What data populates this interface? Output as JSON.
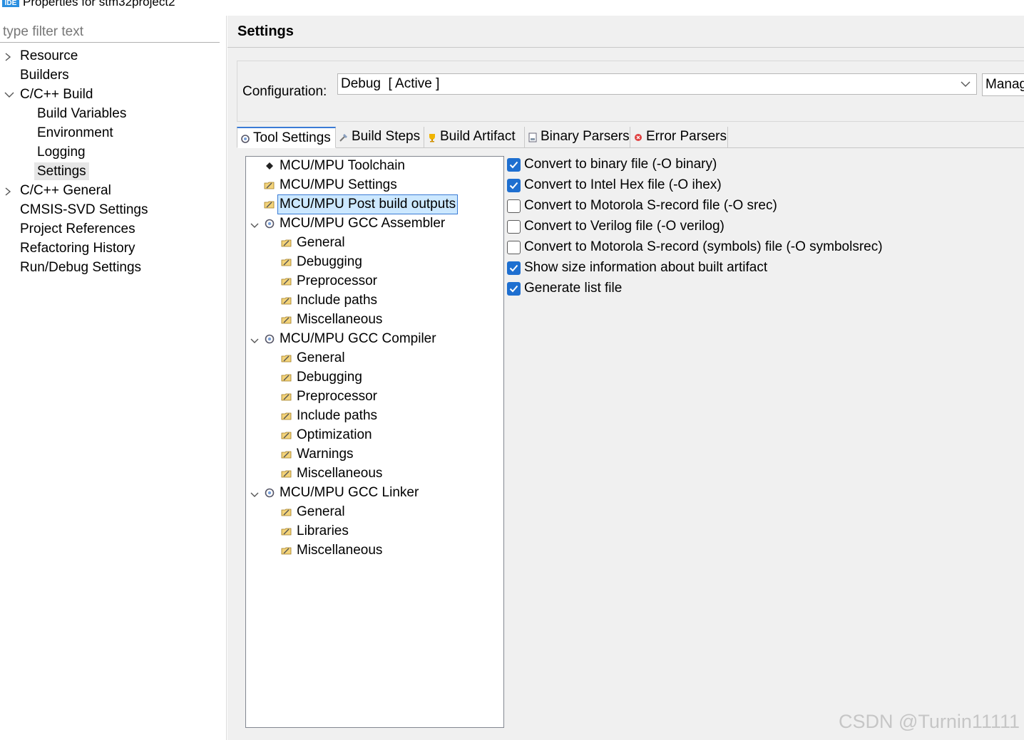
{
  "window": {
    "title": "Properties for stm32project2",
    "icon_text": "IDE"
  },
  "filter": {
    "placeholder": "type filter text"
  },
  "nav": {
    "items": [
      {
        "label": "Resource",
        "chevron": "right"
      },
      {
        "label": "Builders"
      },
      {
        "label": "C/C++ Build",
        "chevron": "down"
      },
      {
        "label": "Build Variables"
      },
      {
        "label": "Environment"
      },
      {
        "label": "Logging"
      },
      {
        "label": "Settings",
        "selected": true
      },
      {
        "label": "C/C++ General",
        "chevron": "right"
      },
      {
        "label": "CMSIS-SVD Settings"
      },
      {
        "label": "Project References"
      },
      {
        "label": "Refactoring History"
      },
      {
        "label": "Run/Debug Settings"
      }
    ]
  },
  "settings": {
    "title": "Settings"
  },
  "configuration": {
    "label": "Configuration:",
    "value": "Debug  [ Active ]",
    "manage_label": "Manage Configurations..."
  },
  "tabs": [
    {
      "label": "Tool Settings",
      "active": true,
      "icon": "tool-settings-icon"
    },
    {
      "label": "Build Steps",
      "icon": "build-steps-icon"
    },
    {
      "label": "Build Artifact",
      "icon": "build-artifact-icon"
    },
    {
      "label": "Binary Parsers",
      "icon": "binary-parsers-icon"
    },
    {
      "label": "Error Parsers",
      "icon": "error-parsers-icon"
    }
  ],
  "tree": {
    "toolchain": "MCU/MPU Toolchain",
    "mpu_settings": "MCU/MPU Settings",
    "post_build": "MCU/MPU Post build outputs",
    "assembler": {
      "label": "MCU/MPU GCC Assembler",
      "children": [
        "General",
        "Debugging",
        "Preprocessor",
        "Include paths",
        "Miscellaneous"
      ]
    },
    "compiler": {
      "label": "MCU/MPU GCC Compiler",
      "children": [
        "General",
        "Debugging",
        "Preprocessor",
        "Include paths",
        "Optimization",
        "Warnings",
        "Miscellaneous"
      ]
    },
    "linker": {
      "label": "MCU/MPU GCC Linker",
      "children": [
        "General",
        "Libraries",
        "Miscellaneous"
      ]
    }
  },
  "options": [
    {
      "label": "Convert to binary file (-O binary)",
      "checked": true
    },
    {
      "label": "Convert to Intel Hex file (-O ihex)",
      "checked": true
    },
    {
      "label": "Convert to Motorola S-record file (-O srec)",
      "checked": false
    },
    {
      "label": "Convert to Verilog file (-O verilog)",
      "checked": false
    },
    {
      "label": "Convert to Motorola S-record (symbols) file (-O symbolsrec)",
      "checked": false
    },
    {
      "label": "Show size information about built artifact",
      "checked": true
    },
    {
      "label": "Generate list file",
      "checked": true
    }
  ],
  "watermark": "CSDN @Turnin11111",
  "colors": {
    "accent": "#1e6fd0",
    "selection": "#cce8ff",
    "panel_bg": "#f0f0f0"
  }
}
